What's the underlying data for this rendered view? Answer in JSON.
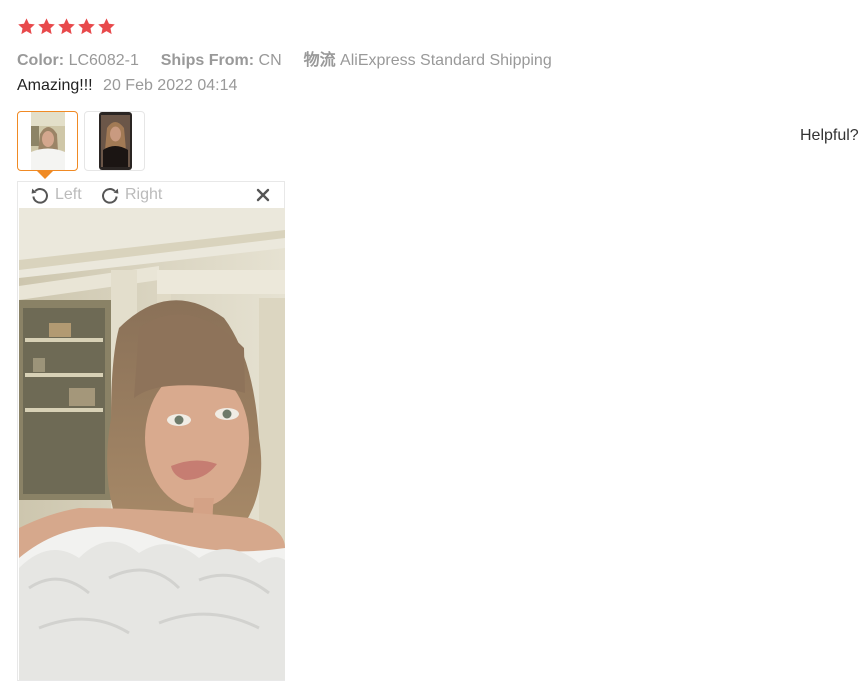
{
  "rating": {
    "stars": 5,
    "max": 5,
    "color": "#e8494b"
  },
  "meta": {
    "color_label": "Color:",
    "color_value": "LC6082-1",
    "ships_label": "Ships From:",
    "ships_value": "CN",
    "logistics_label": "物流",
    "logistics_value": "AliExpress Standard Shipping"
  },
  "review": {
    "text": "Amazing!!!",
    "date": "20 Feb 2022 04:14"
  },
  "helpful_label": "Helpful?",
  "viewer": {
    "rotate_left_label": "Left",
    "rotate_right_label": "Right",
    "close_icon": "close-icon"
  },
  "accent_color": "#f08a24"
}
